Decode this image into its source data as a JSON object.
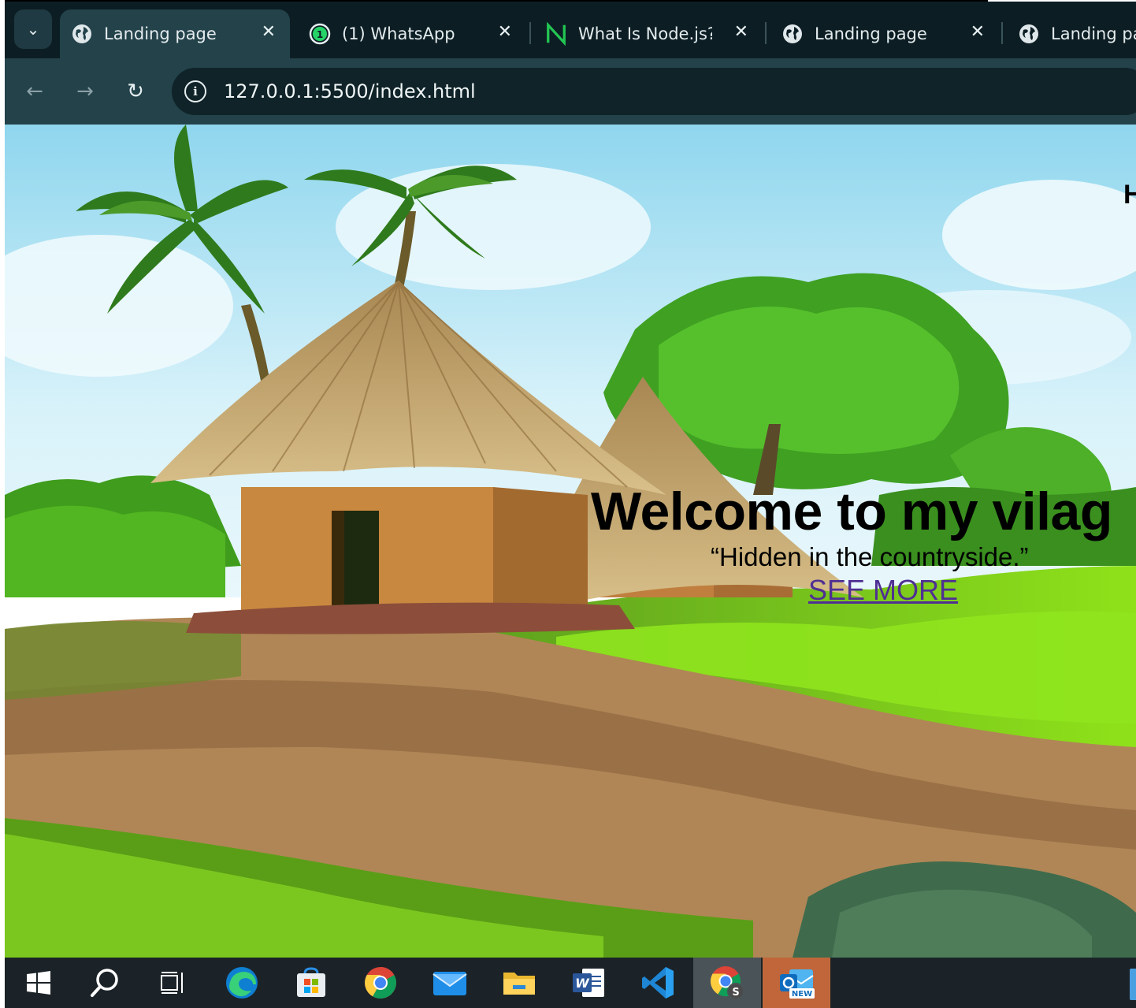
{
  "browser": {
    "tabs": [
      {
        "title": "Landing page",
        "favicon": "globe-icon",
        "active": true
      },
      {
        "title": "(1) WhatsApp",
        "favicon": "whatsapp-icon",
        "active": false
      },
      {
        "title": "What Is Node.js? C",
        "favicon": "nodejs-n-icon",
        "active": false
      },
      {
        "title": "Landing page",
        "favicon": "globe-icon",
        "active": false
      },
      {
        "title": "Landing pag",
        "favicon": "globe-icon",
        "active": false
      }
    ],
    "close_glyph": "✕",
    "tab_search_glyph": "⌄",
    "back_glyph": "←",
    "forward_glyph": "→",
    "reload_glyph": "↻",
    "info_glyph": "i",
    "url": "127.0.0.1:5500/index.html"
  },
  "page": {
    "nav_peek": "H",
    "hero_title": "Welcome to my vilag",
    "hero_quote": "“Hidden in the countryside.”",
    "hero_link": "SEE MORE"
  },
  "taskbar": {
    "items": [
      {
        "icon": "windows-start-icon"
      },
      {
        "icon": "search-icon"
      },
      {
        "icon": "task-view-icon"
      },
      {
        "icon": "edge-icon"
      },
      {
        "icon": "microsoft-store-icon"
      },
      {
        "icon": "chrome-icon"
      },
      {
        "icon": "mail-icon"
      },
      {
        "icon": "file-explorer-icon"
      },
      {
        "icon": "word-icon",
        "label": "W"
      },
      {
        "icon": "vscode-icon"
      },
      {
        "icon": "chrome-profile-icon",
        "label": "S"
      },
      {
        "icon": "outlook-new-icon",
        "label": "NEW"
      }
    ]
  },
  "colors": {
    "tabstrip": "#0c1e24",
    "toolbar": "#23424a",
    "omnibox": "#0f2328",
    "sky": "#bfe8f5",
    "grass": "#7bd21a",
    "path": "#b08656",
    "thatch": "#c9a96e",
    "hut_wall": "#c88a44",
    "link": "#4f2f93",
    "taskbar": "#1b2328"
  }
}
